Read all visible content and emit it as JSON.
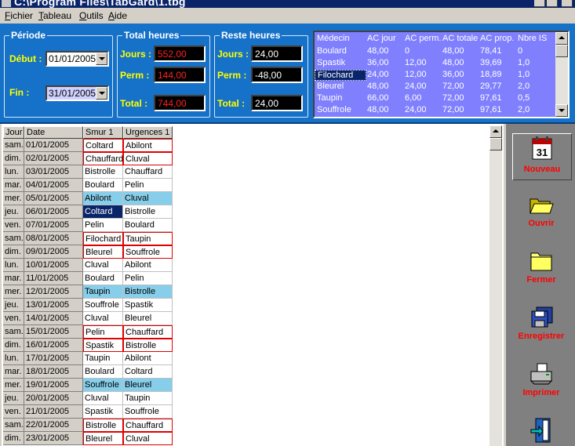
{
  "window": {
    "title": "C:\\Program Files\\TabGard\\1.tbg"
  },
  "menu": [
    {
      "label": "Fichier",
      "accel": "F"
    },
    {
      "label": "Tableau",
      "accel": "T"
    },
    {
      "label": "Outils",
      "accel": "O"
    },
    {
      "label": "Aide",
      "accel": "A"
    }
  ],
  "periode": {
    "title": "Période",
    "debut_label": "Début :",
    "debut_value": "01/01/2005",
    "fin_label": "Fin :",
    "fin_value": "31/01/2005"
  },
  "total_heures": {
    "title": "Total heures",
    "jours_label": "Jours :",
    "jours_value": "552,00",
    "perm_label": "Perm :",
    "perm_value": "144,00",
    "total_label": "Total :",
    "total_value": "744,00"
  },
  "reste_heures": {
    "title": "Reste heures",
    "jours_label": "Jours :",
    "jours_value": "24,00",
    "perm_label": "Perm :",
    "perm_value": "-48,00",
    "total_label": "Total :",
    "total_value": "24,00"
  },
  "medecins": {
    "columns": [
      "Médecin",
      "AC jour",
      "AC perm.",
      "AC totale",
      "AC prop.",
      "Nbre IS"
    ],
    "rows": [
      [
        "Boulard",
        "48,00",
        "0",
        "48,00",
        "78,41",
        "0"
      ],
      [
        "Spastik",
        "36,00",
        "12,00",
        "48,00",
        "39,69",
        "1,0"
      ],
      [
        "Filochard",
        "24,00",
        "12,00",
        "36,00",
        "18,89",
        "1,0"
      ],
      [
        "Bleurel",
        "48,00",
        "24,00",
        "72,00",
        "29,77",
        "2,0"
      ],
      [
        "Taupin",
        "66,00",
        "6,00",
        "72,00",
        "97,61",
        "0,5"
      ],
      [
        "Souffrole",
        "48,00",
        "24,00",
        "72,00",
        "97,61",
        "2,0"
      ]
    ],
    "selected_row": 2
  },
  "grid": {
    "columns": [
      "Jour",
      "Date",
      "Smur 1",
      "Urgences 1"
    ],
    "rows": [
      {
        "jour": "sam.",
        "date": "01/01/2005",
        "smur": "Coltard",
        "urg": "Abilont",
        "style": "red"
      },
      {
        "jour": "dim.",
        "date": "02/01/2005",
        "smur": "Chauffard",
        "urg": "Cluval",
        "style": "red"
      },
      {
        "jour": "lun.",
        "date": "03/01/2005",
        "smur": "Bistrolle",
        "urg": "Chauffard",
        "style": ""
      },
      {
        "jour": "mar.",
        "date": "04/01/2005",
        "smur": "Boulard",
        "urg": "Pelin",
        "style": ""
      },
      {
        "jour": "mer.",
        "date": "05/01/2005",
        "smur": "Abilont",
        "urg": "Cluval",
        "style": "blue"
      },
      {
        "jour": "jeu.",
        "date": "06/01/2005",
        "smur": "Coltard",
        "urg": "Bistrolle",
        "style": "selected"
      },
      {
        "jour": "ven.",
        "date": "07/01/2005",
        "smur": "Pelin",
        "urg": "Boulard",
        "style": ""
      },
      {
        "jour": "sam.",
        "date": "08/01/2005",
        "smur": "Filochard",
        "urg": "Taupin",
        "style": "red"
      },
      {
        "jour": "dim.",
        "date": "09/01/2005",
        "smur": "Bleurel",
        "urg": "Souffrole",
        "style": "red"
      },
      {
        "jour": "lun.",
        "date": "10/01/2005",
        "smur": "Cluval",
        "urg": "Abilont",
        "style": ""
      },
      {
        "jour": "mar.",
        "date": "11/01/2005",
        "smur": "Boulard",
        "urg": "Pelin",
        "style": ""
      },
      {
        "jour": "mer.",
        "date": "12/01/2005",
        "smur": "Taupin",
        "urg": "Bistrolle",
        "style": "blue"
      },
      {
        "jour": "jeu.",
        "date": "13/01/2005",
        "smur": "Souffrole",
        "urg": "Spastik",
        "style": ""
      },
      {
        "jour": "ven.",
        "date": "14/01/2005",
        "smur": "Cluval",
        "urg": "Bleurel",
        "style": ""
      },
      {
        "jour": "sam.",
        "date": "15/01/2005",
        "smur": "Pelin",
        "urg": "Chauffard",
        "style": "red"
      },
      {
        "jour": "dim.",
        "date": "16/01/2005",
        "smur": "Spastik",
        "urg": "Bistrolle",
        "style": "red"
      },
      {
        "jour": "lun.",
        "date": "17/01/2005",
        "smur": "Taupin",
        "urg": "Abilont",
        "style": ""
      },
      {
        "jour": "mar.",
        "date": "18/01/2005",
        "smur": "Boulard",
        "urg": "Coltard",
        "style": ""
      },
      {
        "jour": "mer.",
        "date": "19/01/2005",
        "smur": "Souffrole",
        "urg": "Bleurel",
        "style": "blue"
      },
      {
        "jour": "jeu.",
        "date": "20/01/2005",
        "smur": "Cluval",
        "urg": "Taupin",
        "style": ""
      },
      {
        "jour": "ven.",
        "date": "21/01/2005",
        "smur": "Spastik",
        "urg": "Souffrole",
        "style": ""
      },
      {
        "jour": "sam.",
        "date": "22/01/2005",
        "smur": "Bistrolle",
        "urg": "Chauffard",
        "style": "red"
      },
      {
        "jour": "dim.",
        "date": "23/01/2005",
        "smur": "Bleurel",
        "urg": "Cluval",
        "style": "red"
      }
    ]
  },
  "toolbar": {
    "nouveau": {
      "label": "Nouveau",
      "icon": "calendar-icon",
      "calendar_day": "31"
    },
    "ouvrir": {
      "label": "Ouvrir",
      "icon": "folder-open-icon"
    },
    "fermer": {
      "label": "Fermer",
      "icon": "folder-closed-icon"
    },
    "enregistrer": {
      "label": "Enregistrer",
      "icon": "floppy-disk-icon"
    },
    "imprimer": {
      "label": "Imprimer",
      "icon": "printer-icon"
    },
    "quitter": {
      "icon": "exit-door-icon"
    }
  },
  "colors": {
    "panel_blue": "#1672c8",
    "label_yellow": "#ffff00",
    "value_red": "#ff2020",
    "medecin_bg": "#8080ff",
    "row_blue": "#87ceeb",
    "selection": "#0a246a",
    "toolbar_gray": "#808080"
  }
}
